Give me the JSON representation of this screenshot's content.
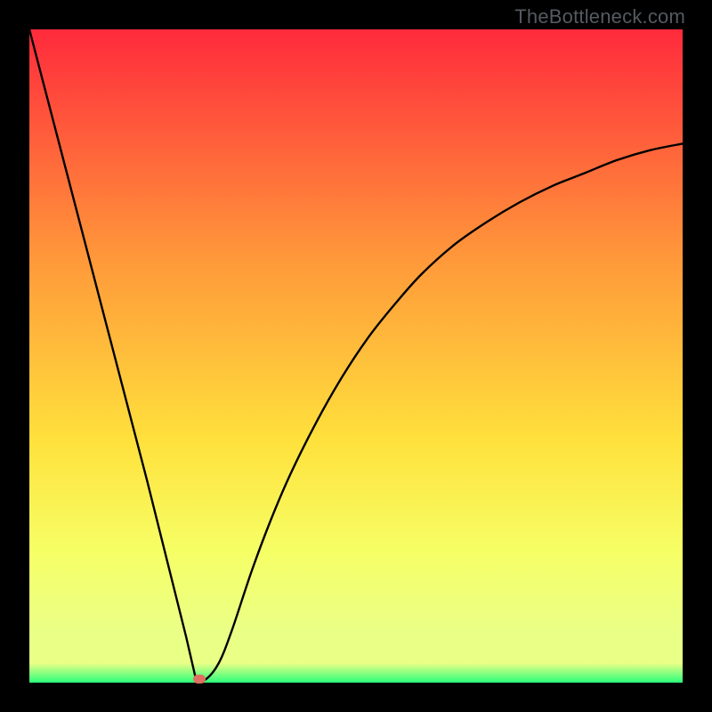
{
  "attribution": "TheBottleneck.com",
  "chart_data": {
    "type": "line",
    "title": "",
    "xlabel": "",
    "ylabel": "",
    "xlim": [
      0,
      100
    ],
    "ylim": [
      0,
      100
    ],
    "gradient": {
      "top": "#ff2a3c",
      "mid_upper": "#ff983a",
      "mid": "#ffe13c",
      "mid_lower": "#f6ff66",
      "band": "#eaff86",
      "bottom": "#2cff7b"
    },
    "series": [
      {
        "name": "bottleneck-curve",
        "x": [
          0,
          3,
          6,
          9,
          12,
          15,
          18,
          21,
          24,
          25.5,
          27,
          29,
          31,
          34,
          37,
          40,
          44,
          48,
          52,
          56,
          60,
          65,
          70,
          75,
          80,
          85,
          90,
          95,
          100
        ],
        "values": [
          100,
          88.5,
          77,
          65.5,
          54,
          42.5,
          31,
          19,
          7,
          0.5,
          0.5,
          3,
          8,
          17,
          25,
          32,
          40,
          47,
          53,
          58,
          62.5,
          67,
          70.5,
          73.5,
          76,
          78,
          80,
          81.5,
          82.5
        ]
      }
    ],
    "markers": [
      {
        "name": "optimal-point",
        "x": 26,
        "y": 0.5,
        "color": "#e07060"
      }
    ]
  }
}
